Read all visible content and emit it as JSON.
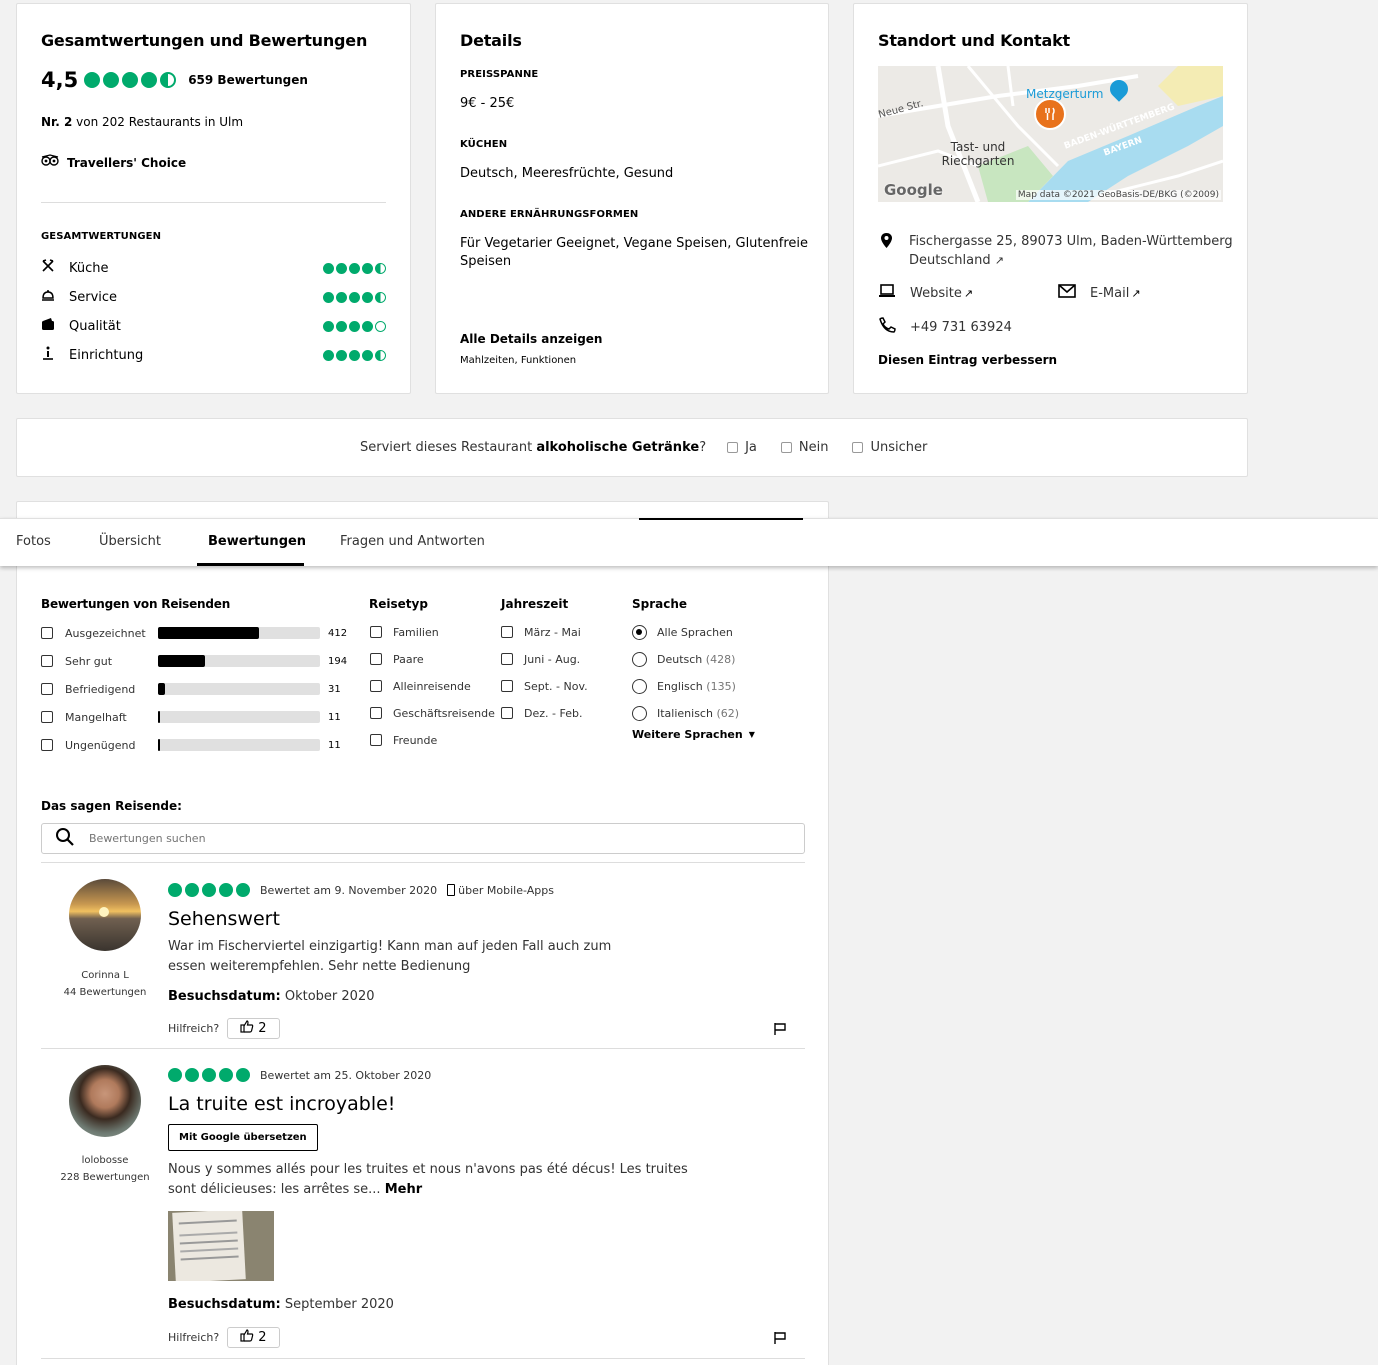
{
  "ratings_card": {
    "title": "Gesamtwertungen und Bewertungen",
    "score": "4,5",
    "review_count": "659 Bewertungen",
    "rank_prefix": "Nr. 2",
    "rank_suffix": "von 202 Restaurants in Ulm",
    "award": "Travellers' Choice",
    "sub_heading": "GESAMTWERTUNGEN",
    "subratings": [
      {
        "label": "Küche",
        "icon": "utensils-icon",
        "rating": 4.5
      },
      {
        "label": "Service",
        "icon": "service-bell-icon",
        "rating": 4.5
      },
      {
        "label": "Qualität",
        "icon": "wallet-icon",
        "rating": 4.0
      },
      {
        "label": "Einrichtung",
        "icon": "ambience-icon",
        "rating": 4.5
      }
    ]
  },
  "details_card": {
    "title": "Details",
    "price_heading": "PREISSPANNE",
    "price": "9€ - 25€",
    "cuisine_heading": "KÜCHEN",
    "cuisine": "Deutsch, Meeresfrüchte, Gesund",
    "diet_heading": "ANDERE ERNÄHRUNGSFORMEN",
    "diet": "Für Vegetarier Geeignet, Vegane Speisen, Glutenfreie Speisen",
    "all_details": "Alle Details anzeigen",
    "all_details_sub": "Mahlzeiten, Funktionen"
  },
  "location_card": {
    "title": "Standort und Kontakt",
    "map": {
      "poi": "Metzgerturm",
      "area": "Tast- und Riechgarten",
      "street": "Neue Str.",
      "region1": "BADEN-WÜRTTEMBERG",
      "region2": "BAYERN",
      "logo": "Google",
      "attribution": "Map data ©2021 GeoBasis-DE/BKG (©2009)"
    },
    "address_line1": "Fischergasse 25, 89073 Ulm, Baden-Württemberg",
    "address_line2": "Deutschland",
    "website": "Website",
    "email": "E-Mail",
    "phone": "+49 731 63924",
    "improve": "Diesen Eintrag verbessern"
  },
  "alcohol": {
    "prefix": "Serviert dieses Restaurant",
    "bold": "alkoholische Getränke",
    "suffix": "?",
    "options": [
      "Ja",
      "Nein",
      "Unsicher"
    ]
  },
  "tabs": [
    "Fotos",
    "Übersicht",
    "Bewertungen",
    "Fragen und Antworten"
  ],
  "active_tab": "Bewertungen",
  "reviews_panel": {
    "traveler_heading": "Bewertungen von Reisenden",
    "traveler_ratings": [
      {
        "label": "Ausgezeichnet",
        "count": "412",
        "fraction": 0.625
      },
      {
        "label": "Sehr gut",
        "count": "194",
        "fraction": 0.29
      },
      {
        "label": "Befriedigend",
        "count": "31",
        "fraction": 0.045
      },
      {
        "label": "Mangelhaft",
        "count": "11",
        "fraction": 0.012
      },
      {
        "label": "Ungenügend",
        "count": "11",
        "fraction": 0.012
      }
    ],
    "type_heading": "Reisetyp",
    "types": [
      "Familien",
      "Paare",
      "Alleinreisende",
      "Geschäftsreisende",
      "Freunde"
    ],
    "season_heading": "Jahreszeit",
    "seasons": [
      "März - Mai",
      "Juni - Aug.",
      "Sept. - Nov.",
      "Dez. - Feb."
    ],
    "language_heading": "Sprache",
    "languages": [
      {
        "label": "Alle Sprachen",
        "count": "",
        "selected": true
      },
      {
        "label": "Deutsch",
        "count": "(428)",
        "selected": false
      },
      {
        "label": "Englisch",
        "count": "(135)",
        "selected": false
      },
      {
        "label": "Italienisch",
        "count": "(62)",
        "selected": false
      }
    ],
    "more_languages": "Weitere Sprachen",
    "say_heading": "Das sagen Reisende:",
    "search_placeholder": "Bewertungen suchen"
  },
  "reviews": [
    {
      "user": "Corinna L",
      "user_count": "44 Bewertungen",
      "rating": 5,
      "date": "Bewertet am 9. November 2020",
      "via": "über Mobile-Apps",
      "title": "Sehenswert",
      "text": "War im Fischerviertel einzigartig! Kann man auf jeden Fall auch zum essen weiterempfehlen. Sehr nette Bedienung",
      "visit_label": "Besuchsdatum:",
      "visit": "Oktober 2020",
      "helpful_label": "Hilfreich?",
      "helpful_count": "2"
    },
    {
      "user": "lolobosse",
      "user_count": "228 Bewertungen",
      "rating": 5,
      "date": "Bewertet am 25. Oktober 2020",
      "title": "La truite est incroyable!",
      "translate": "Mit Google übersetzen",
      "text": "Nous y sommes allés pour les truites et nous n'avons pas été décus! Les truites sont délicieuses: les arrêtes se...",
      "more": "Mehr",
      "visit_label": "Besuchsdatum:",
      "visit": "September 2020",
      "helpful_label": "Hilfreich?",
      "helpful_count": "2"
    }
  ],
  "colors": {
    "bubble_green": "#00aa6c",
    "map_pin": "#e8721c",
    "poi_blue": "#1a9bd7"
  }
}
